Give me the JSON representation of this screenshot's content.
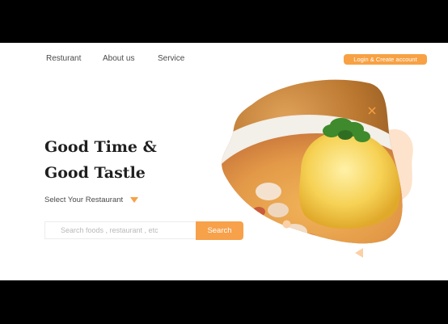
{
  "nav": {
    "items": [
      {
        "label": "Resturant"
      },
      {
        "label": "About us"
      },
      {
        "label": "Service"
      }
    ],
    "login_label": "Login & Create account"
  },
  "hero": {
    "headline_line1": "Good Time &",
    "headline_line2": "Good Tastle",
    "select_label": "Select Your Restaurant",
    "search_placeholder": "Search foods , restaurant , etc",
    "search_button": "Search"
  },
  "colors": {
    "accent": "#f7a144",
    "accent_light": "#fde3cc",
    "text_dark": "#1f1f1f"
  },
  "icons": {
    "dropdown": "triangle-down-icon",
    "close_deco": "x-icon"
  }
}
